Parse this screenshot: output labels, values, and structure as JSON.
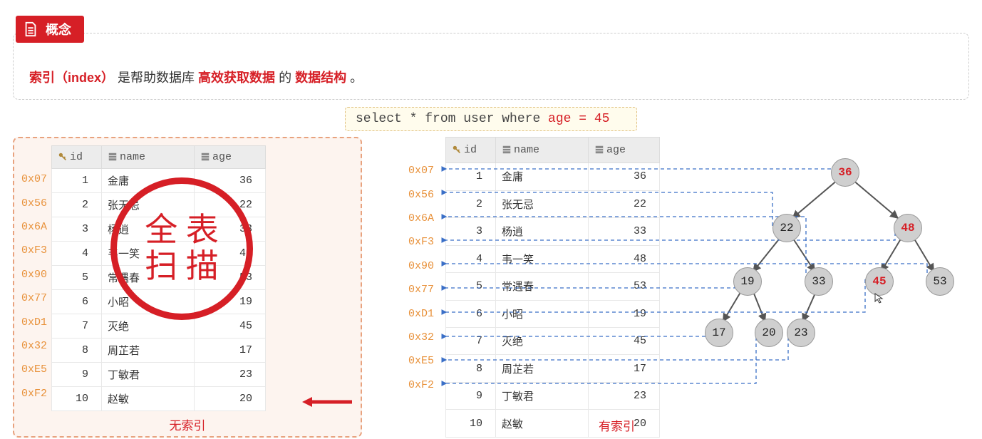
{
  "badge": {
    "label": "概念"
  },
  "concept": {
    "t1": "索引",
    "t2": "（index）",
    "t3": "是帮助数据库 ",
    "t4": "高效获取数据",
    "t5": " 的 ",
    "t6": "数据结构",
    "t7": " 。"
  },
  "query": {
    "part1": "select * from user where ",
    "part2": "age = 45"
  },
  "columns": {
    "id": "id",
    "name": "name",
    "age": "age"
  },
  "rows": [
    {
      "addr": "0x07",
      "id": "1",
      "name": "金庸",
      "age": "36"
    },
    {
      "addr": "0x56",
      "id": "2",
      "name": "张无忌",
      "age": "22"
    },
    {
      "addr": "0x6A",
      "id": "3",
      "name": "杨逍",
      "age": "33"
    },
    {
      "addr": "0xF3",
      "id": "4",
      "name": "韦一笑",
      "age": "48"
    },
    {
      "addr": "0x90",
      "id": "5",
      "name": "常遇春",
      "age": "53"
    },
    {
      "addr": "0x77",
      "id": "6",
      "name": "小昭",
      "age": "19"
    },
    {
      "addr": "0xD1",
      "id": "7",
      "name": "灭绝",
      "age": "45"
    },
    {
      "addr": "0x32",
      "id": "8",
      "name": "周芷若",
      "age": "17"
    },
    {
      "addr": "0xE5",
      "id": "9",
      "name": "丁敏君",
      "age": "23"
    },
    {
      "addr": "0xF2",
      "id": "10",
      "name": "赵敏",
      "age": "20"
    }
  ],
  "stamp": {
    "line1": "全 表",
    "line2": "扫 描"
  },
  "labels": {
    "left": "无索引",
    "right": "有索引"
  },
  "tree": {
    "nodes": {
      "n36": "36",
      "n22": "22",
      "n48": "48",
      "n19": "19",
      "n33": "33",
      "n45": "45",
      "n53": "53",
      "n17": "17",
      "n20": "20",
      "n23": "23"
    }
  }
}
